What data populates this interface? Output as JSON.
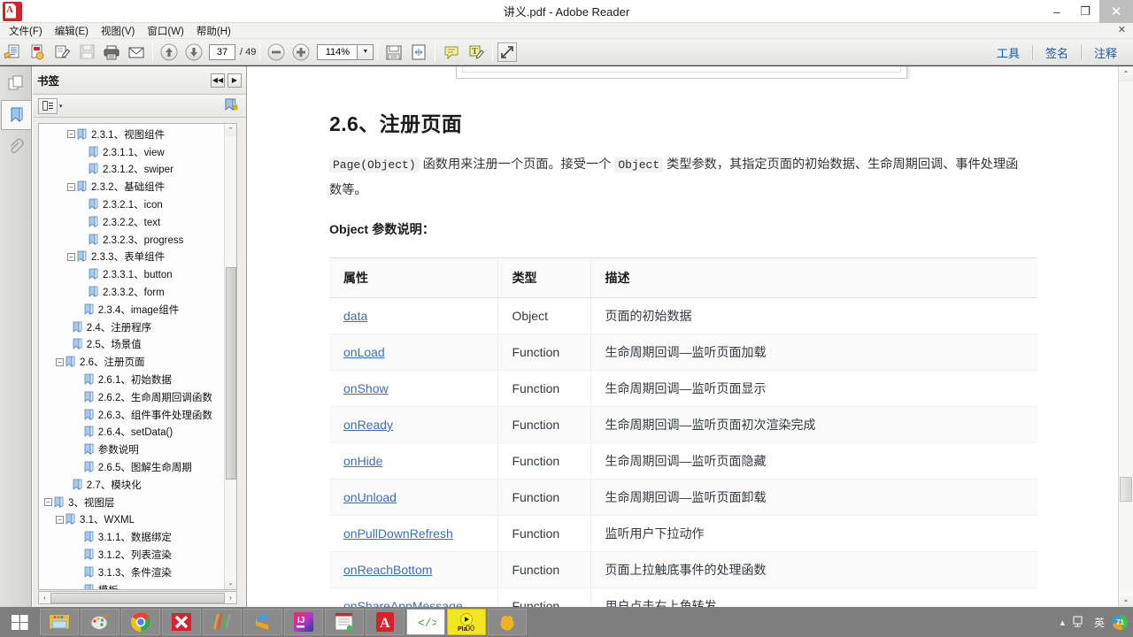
{
  "window": {
    "title": "讲义.pdf - Adobe Reader",
    "app_icon": "adobe-pdf-icon",
    "minimize": "–",
    "maximize": "❐",
    "close": "✕"
  },
  "menubar": {
    "items": [
      {
        "label": "文件(F)"
      },
      {
        "label": "编辑(E)"
      },
      {
        "label": "视图(V)"
      },
      {
        "label": "窗口(W)"
      },
      {
        "label": "帮助(H)"
      }
    ],
    "close_x": "✕"
  },
  "toolbar": {
    "page_current": "37",
    "page_total": "/ 49",
    "zoom_level": "114%",
    "zoom_dropdown": "▼",
    "links": [
      {
        "label": "工具"
      },
      {
        "label": "签名"
      },
      {
        "label": "注释"
      }
    ]
  },
  "rail": {
    "items": [
      {
        "name": "page-thumbnails-icon"
      },
      {
        "name": "bookmarks-icon"
      },
      {
        "name": "attachments-icon"
      }
    ]
  },
  "bookmarks_panel": {
    "title": "书签",
    "nav_prev": "◀◀",
    "nav_next": "▶",
    "options_caret": "▾",
    "hscroll_left": "‹",
    "hscroll_right": "›",
    "scroll_up": "⌃",
    "scroll_down": "⌄",
    "tree": [
      {
        "indent": 2,
        "expander": "−",
        "label": "2.3.1、视图组件"
      },
      {
        "indent": 3,
        "expander": "",
        "label": "2.3.1.1、view"
      },
      {
        "indent": 3,
        "expander": "",
        "label": "2.3.1.2、swiper"
      },
      {
        "indent": 2,
        "expander": "−",
        "label": "2.3.2、基础组件"
      },
      {
        "indent": 3,
        "expander": "",
        "label": "2.3.2.1、icon"
      },
      {
        "indent": 3,
        "expander": "",
        "label": "2.3.2.2、text"
      },
      {
        "indent": 3,
        "expander": "",
        "label": "2.3.2.3、progress"
      },
      {
        "indent": 2,
        "expander": "−",
        "label": "2.3.3、表单组件"
      },
      {
        "indent": 3,
        "expander": "",
        "label": "2.3.3.1、button"
      },
      {
        "indent": 3,
        "expander": "",
        "label": "2.3.3.2、form"
      },
      {
        "indent": 2.6,
        "expander": "",
        "label": "2.3.4、image组件"
      },
      {
        "indent": 1.6,
        "expander": "",
        "label": "2.4、注册程序"
      },
      {
        "indent": 1.6,
        "expander": "",
        "label": "2.5、场景值"
      },
      {
        "indent": 1,
        "expander": "−",
        "label": "2.6、注册页面"
      },
      {
        "indent": 2.6,
        "expander": "",
        "label": "2.6.1、初始数据"
      },
      {
        "indent": 2.6,
        "expander": "",
        "label": "2.6.2、生命周期回调函数"
      },
      {
        "indent": 2.6,
        "expander": "",
        "label": "2.6.3、组件事件处理函数"
      },
      {
        "indent": 2.6,
        "expander": "",
        "label": "2.6.4、setData()"
      },
      {
        "indent": 2.6,
        "expander": "",
        "label": "参数说明"
      },
      {
        "indent": 2.6,
        "expander": "",
        "label": "2.6.5、图解生命周期"
      },
      {
        "indent": 1.6,
        "expander": "",
        "label": "2.7、模块化"
      },
      {
        "indent": 0,
        "expander": "−",
        "label": "3、视图层"
      },
      {
        "indent": 1,
        "expander": "−",
        "label": "3.1、WXML"
      },
      {
        "indent": 2.6,
        "expander": "",
        "label": "3.1.1、数据绑定"
      },
      {
        "indent": 2.6,
        "expander": "",
        "label": "3.1.2、列表渲染"
      },
      {
        "indent": 2.6,
        "expander": "",
        "label": "3.1.3、条件渲染"
      },
      {
        "indent": 2.6,
        "expander": "",
        "label": "模板"
      }
    ]
  },
  "document": {
    "heading": "2.6、注册页面",
    "paragraph": {
      "code1": "Page(Object)",
      "text1": " 函数用来注册一个页面。接受一个 ",
      "code2": "Object",
      "text2": " 类型参数，其指定页面的初始数据、生命周期回调、事件处理函数等。"
    },
    "subheading": "Object 参数说明：",
    "table": {
      "headers": [
        "属性",
        "类型",
        "描述"
      ],
      "rows": [
        {
          "attr": "data",
          "type": "Object",
          "desc": "页面的初始数据"
        },
        {
          "attr": "onLoad",
          "type": "Function",
          "desc": "生命周期回调—监听页面加载"
        },
        {
          "attr": "onShow",
          "type": "Function",
          "desc": "生命周期回调—监听页面显示"
        },
        {
          "attr": "onReady",
          "type": "Function",
          "desc": "生命周期回调—监听页面初次渲染完成"
        },
        {
          "attr": "onHide",
          "type": "Function",
          "desc": "生命周期回调—监听页面隐藏"
        },
        {
          "attr": "onUnload",
          "type": "Function",
          "desc": "生命周期回调—监听页面卸载"
        },
        {
          "attr": "onPullDownRefresh",
          "type": "Function",
          "desc": "监听用户下拉动作"
        },
        {
          "attr": "onReachBottom",
          "type": "Function",
          "desc": "页面上拉触底事件的处理函数"
        },
        {
          "attr": "onShareAppMessage",
          "type": "Function",
          "desc": "用户点击右上角转发"
        }
      ]
    },
    "scroll_up": "⌃",
    "scroll_down": "⌄"
  },
  "taskbar": {
    "start": "windows-logo-icon",
    "apps": [
      {
        "name": "file-explorer-icon"
      },
      {
        "name": "paint-icon"
      },
      {
        "name": "chrome-icon"
      },
      {
        "name": "xmind-icon"
      },
      {
        "name": "colorstrips-icon"
      },
      {
        "name": "sublime-icon"
      },
      {
        "name": "intellij-idea-icon"
      },
      {
        "name": "notepad-icon"
      },
      {
        "name": "adobe-reader-icon"
      },
      {
        "name": "code-editor-icon"
      },
      {
        "name": "media-player-icon",
        "active": true
      },
      {
        "name": "orange-app-icon"
      }
    ],
    "tray": {
      "expand": "▴",
      "network": "⛶",
      "ime": "英",
      "badge": "71"
    }
  },
  "colors": {
    "accent_link": "#1959a8",
    "doc_link": "#3d6fb4",
    "taskbar": "#7e7e7e",
    "active_task": "#f4e520"
  }
}
